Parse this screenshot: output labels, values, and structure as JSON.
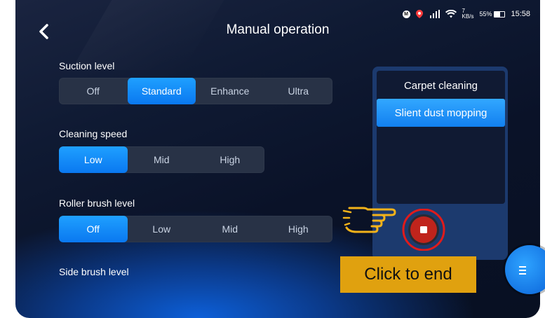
{
  "header": {
    "title": "Manual operation"
  },
  "status_bar": {
    "badge": "M",
    "network_speed_value": "7",
    "network_speed_unit": "KB/s",
    "battery": "55%",
    "time": "15:58"
  },
  "suction": {
    "label": "Suction level",
    "options": [
      "Off",
      "Standard",
      "Enhance",
      "Ultra"
    ],
    "selected": "Standard"
  },
  "speed": {
    "label": "Cleaning speed",
    "options": [
      "Low",
      "Mid",
      "High"
    ],
    "selected": "Low"
  },
  "roller": {
    "label": "Roller brush level",
    "options": [
      "Off",
      "Low",
      "Mid",
      "High"
    ],
    "selected": "Off"
  },
  "side_brush": {
    "label": "Side brush level"
  },
  "modes": {
    "items": [
      "Carpet cleaning",
      "Slient dust mopping"
    ],
    "selected": "Slient dust mopping"
  },
  "tooltip": {
    "text": "Click to end"
  },
  "colors": {
    "accent": "#1a8cff",
    "stop_ring": "#e01b1b",
    "tooltip_bg": "#e0a10f",
    "hand": "#f2b21a"
  },
  "icons": {
    "back": "chevron-left-icon",
    "stop": "stop-icon",
    "pointer": "pointing-hand-icon",
    "menu": "menu-icon"
  }
}
